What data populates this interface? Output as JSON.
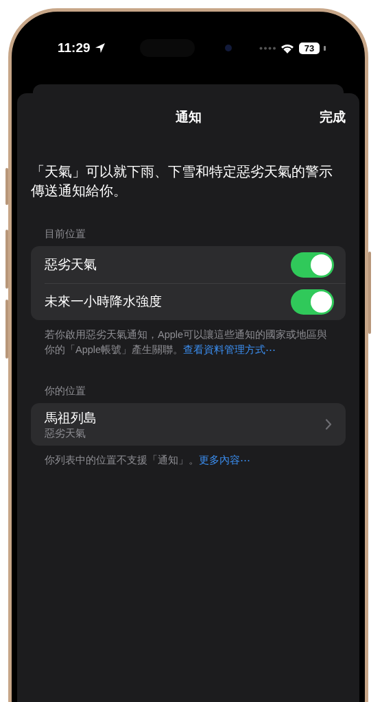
{
  "status_bar": {
    "time": "11:29",
    "battery": "73"
  },
  "nav": {
    "title": "通知",
    "done": "完成"
  },
  "description": "「天氣」可以就下雨、下雪和特定惡劣天氣的警示傳送通知給你。",
  "sections": [
    {
      "header": "目前位置",
      "rows": [
        {
          "kind": "toggle",
          "label": "惡劣天氣",
          "on": true
        },
        {
          "kind": "toggle",
          "label": "未來一小時降水強度",
          "on": true
        }
      ],
      "footer": {
        "text": "若你啟用惡劣天氣通知，Apple可以讓這些通知的國家或地區與你的「Apple帳號」產生關聯。",
        "link": "查看資料管理方式⋯"
      }
    },
    {
      "header": "你的位置",
      "rows": [
        {
          "kind": "nav",
          "label": "馬祖列島",
          "subtitle": "惡劣天氣"
        }
      ],
      "footer": {
        "text": "你列表中的位置不支援「通知」。",
        "link": "更多內容⋯"
      }
    }
  ]
}
